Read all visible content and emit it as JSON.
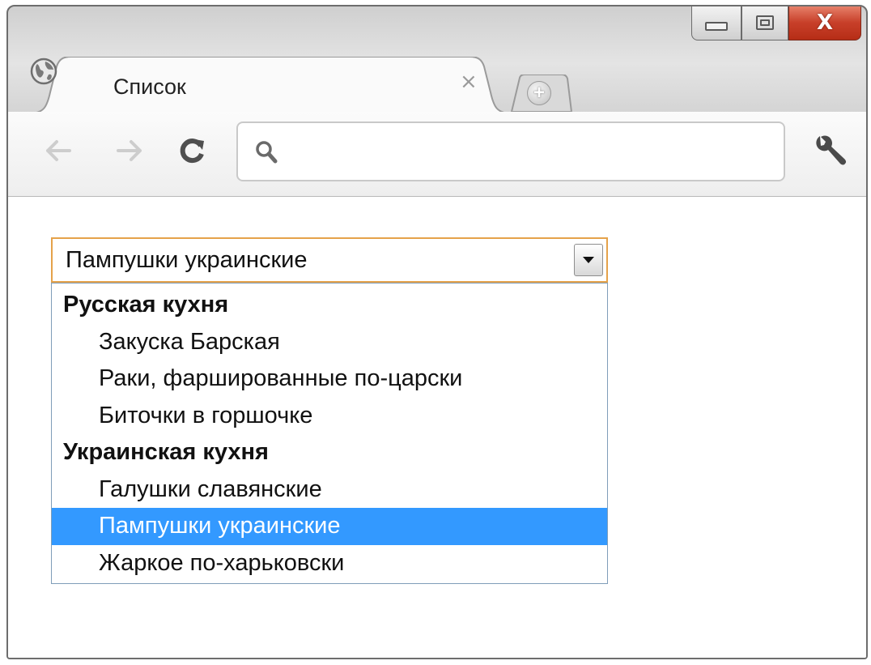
{
  "browser": {
    "tab_title": "Список",
    "tab_close_glyph": "×",
    "new_tab_glyph": "+",
    "window_close_glyph": "X",
    "address_value": "",
    "icons": {
      "favicon": "globe-icon",
      "back": "back-arrow-icon",
      "forward": "forward-arrow-icon",
      "reload": "reload-icon",
      "search": "search-icon",
      "menu": "wrench-icon"
    }
  },
  "select": {
    "value": "Пампушки украинские",
    "groups": [
      {
        "label": "Русская кухня",
        "options": [
          {
            "label": "Закуска Барская",
            "selected": false
          },
          {
            "label": "Раки, фаршированные по-царски",
            "selected": false
          },
          {
            "label": "Биточки в горшочке",
            "selected": false
          }
        ]
      },
      {
        "label": "Украинская кухня",
        "options": [
          {
            "label": "Галушки славянские",
            "selected": false
          },
          {
            "label": "Пампушки украинские",
            "selected": true
          },
          {
            "label": "Жаркое по-харьковски",
            "selected": false
          }
        ]
      }
    ]
  },
  "colors": {
    "selected_option_bg": "#3399ff",
    "select_focus_border": "#e5a24a",
    "close_button": "#c8402a"
  }
}
